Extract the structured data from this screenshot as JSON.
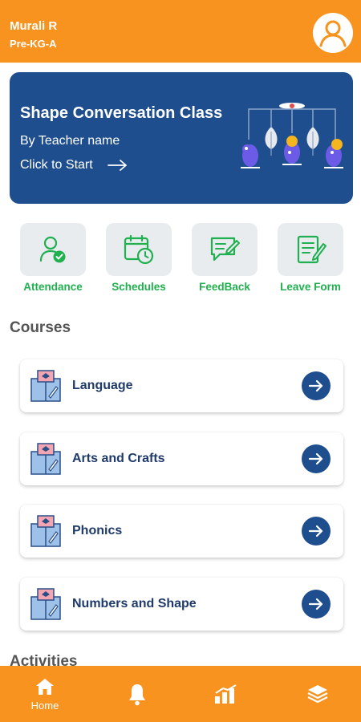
{
  "header": {
    "user_name": "Murali R",
    "class_name": "Pre-KG-A",
    "avatar_icon": "user-avatar-icon"
  },
  "banner": {
    "title": "Shape Conversation Class",
    "teacher": "By Teacher name",
    "cta": "Click to Start",
    "background": "#1F4E8F"
  },
  "quick_actions": [
    {
      "label": "Attendance",
      "icon": "attendance-icon"
    },
    {
      "label": "Schedules",
      "icon": "calendar-clock-icon"
    },
    {
      "label": "FeedBack",
      "icon": "feedback-icon"
    },
    {
      "label": "Leave Form",
      "icon": "leave-form-icon"
    }
  ],
  "courses": {
    "title": "Courses",
    "items": [
      {
        "label": "Language"
      },
      {
        "label": "Arts and Crafts"
      },
      {
        "label": "Phonics"
      },
      {
        "label": "Numbers and Shape"
      }
    ]
  },
  "activities": {
    "title": "Activities"
  },
  "bottom_nav": {
    "items": [
      {
        "label": "Home",
        "icon": "home-icon",
        "active": true
      },
      {
        "label": "",
        "icon": "bell-icon"
      },
      {
        "label": "",
        "icon": "chart-icon"
      },
      {
        "label": "",
        "icon": "layers-icon"
      }
    ]
  },
  "colors": {
    "accent": "#F7931E",
    "primary": "#1F4E8F",
    "green": "#21B04F",
    "tile_bg": "#E8ECEF"
  }
}
